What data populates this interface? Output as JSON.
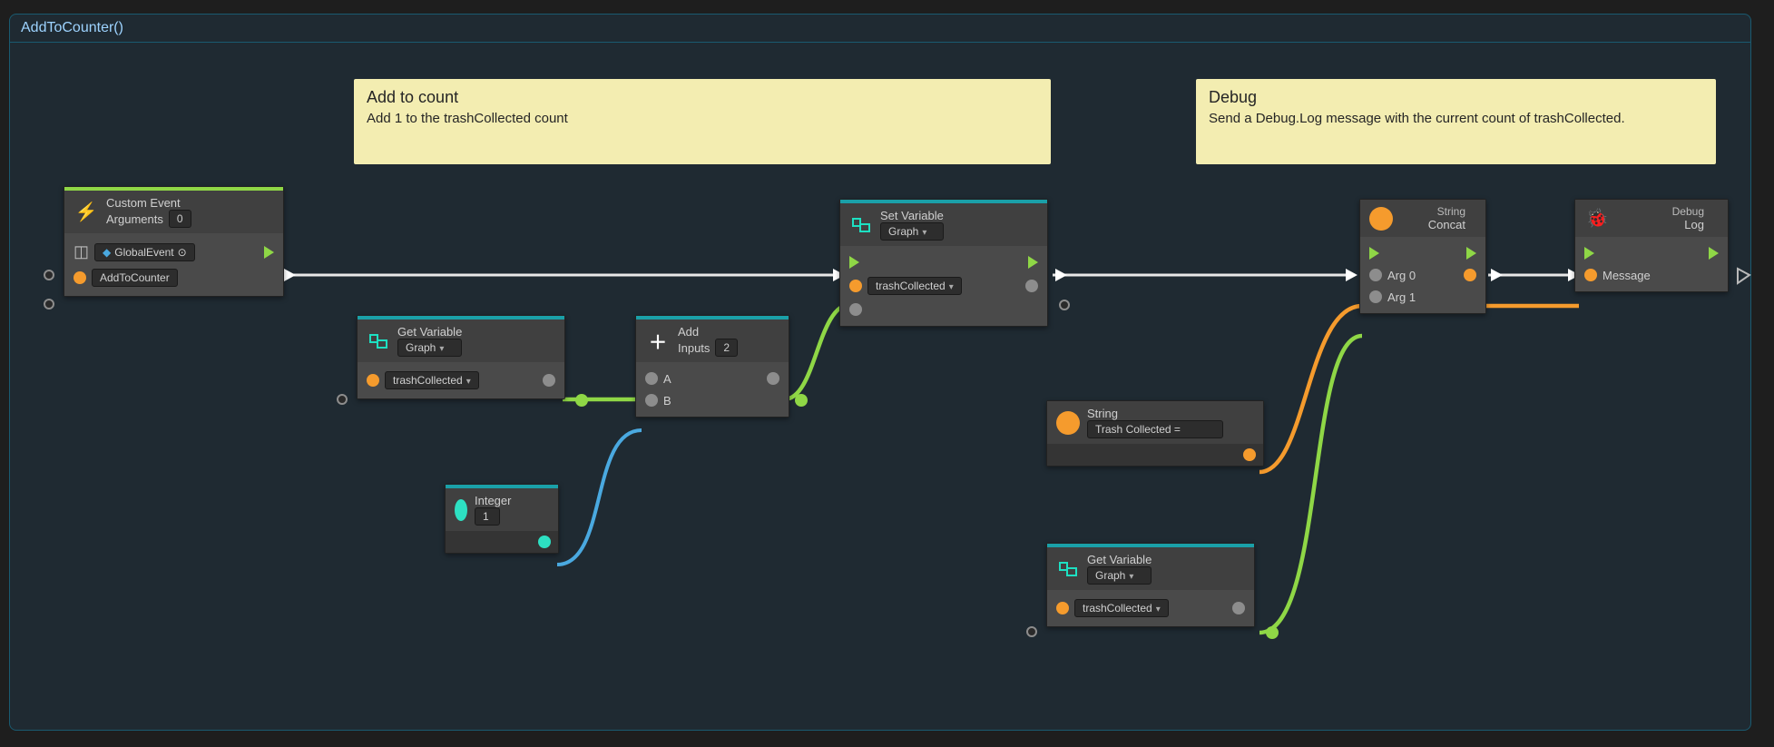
{
  "group": {
    "title": "AddToCounter()"
  },
  "comments": {
    "addcount": {
      "title": "Add to count",
      "body": "Add 1 to the trashCollected count"
    },
    "debug": {
      "title": "Debug",
      "body": "Send a Debug.Log message with the current count of trashCollected."
    }
  },
  "nodes": {
    "customEvent": {
      "title": "Custom Event",
      "argsLabel": "Arguments",
      "argsValue": "0",
      "targetLabel": "GlobalEvent",
      "eventName": "AddToCounter"
    },
    "getVar": {
      "title": "Get Variable",
      "scope": "Graph",
      "variable": "trashCollected"
    },
    "integer": {
      "title": "Integer",
      "value": "1"
    },
    "add": {
      "title": "Add",
      "inputsLabel": "Inputs",
      "inputsValue": "2",
      "a": "A",
      "b": "B"
    },
    "setVar": {
      "title": "Set Variable",
      "scope": "Graph",
      "variable": "trashCollected"
    },
    "stringLit": {
      "title": "String",
      "value": "Trash Collected ="
    },
    "getVar2": {
      "title": "Get Variable",
      "scope": "Graph",
      "variable": "trashCollected"
    },
    "concat": {
      "kind": "String",
      "title": "Concat",
      "arg0": "Arg 0",
      "arg1": "Arg 1"
    },
    "debugLog": {
      "kind": "Debug",
      "title": "Log",
      "message": "Message"
    }
  }
}
